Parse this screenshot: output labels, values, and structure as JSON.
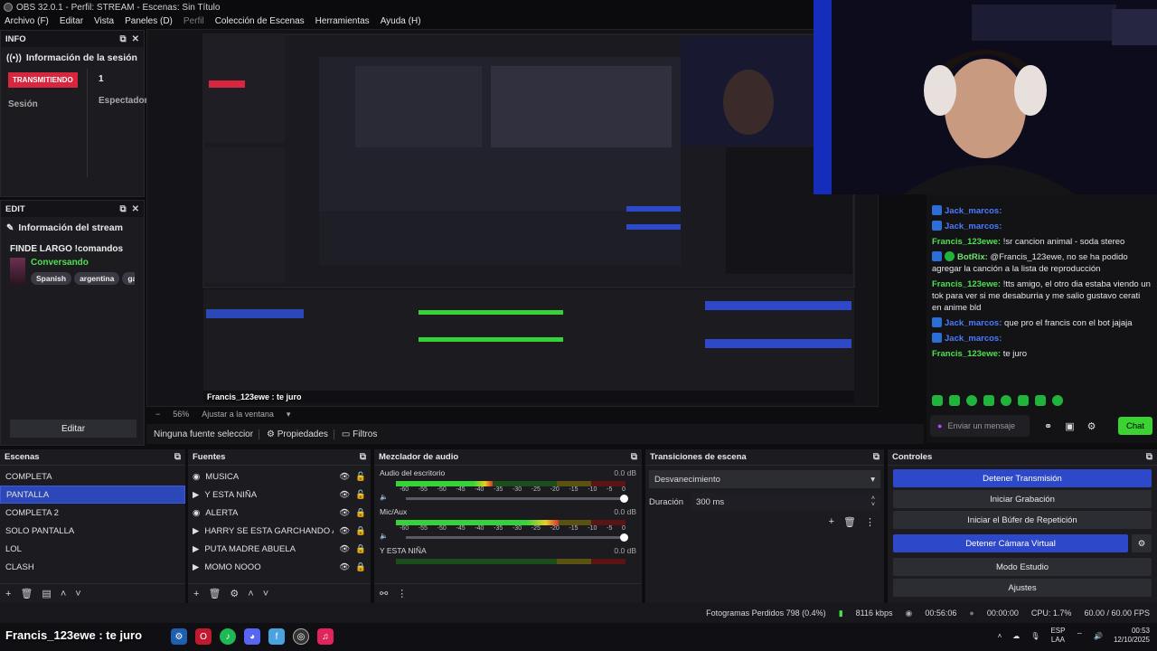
{
  "window": {
    "title": "OBS 32.0.1 - Perfil: STREAM - Escenas: Sin Título"
  },
  "menu": [
    "Archivo (F)",
    "Editar",
    "Vista",
    "Paneles (D)",
    "Perfil",
    "Colección de Escenas",
    "Herramientas",
    "Ayuda (H)"
  ],
  "info_dock": {
    "title": "INFO",
    "section": "Información de la sesión",
    "live_badge": "TRANSMITIENDO",
    "session_label": "Sesión",
    "viewers_count": "1",
    "viewers_label": "Espectador"
  },
  "edit_dock": {
    "title": "EDIT",
    "section": "Información del stream",
    "stream_title": "FINDE LARGO !comandos",
    "category": "Conversando",
    "tags": [
      "Spanish",
      "argentina",
      "ga"
    ],
    "edit_button": "Editar"
  },
  "preview_toolbar": {
    "zoom": "56%",
    "fit_label": "Ajustar a la ventana",
    "no_source": "Ninguna fuente seleccionad",
    "properties_button": "Propiedades",
    "filters_button": "Filtros"
  },
  "scenes": {
    "title": "Escenas",
    "items": [
      "COMPLETA",
      "PANTALLA",
      "COMPLETA 2",
      "SOLO PANTALLA",
      "LOL",
      "CLASH"
    ],
    "selected": "PANTALLA"
  },
  "sources": {
    "title": "Fuentes",
    "items": [
      "MUSICA",
      "Y ESTA NIÑA",
      "ALERTA",
      "HARRY SE ESTA GARCHANDO A TC",
      "PUTA MADRE ABUELA",
      "MOMO NOOO"
    ]
  },
  "mixer": {
    "title": "Mezclador de audio",
    "channels": [
      {
        "name": "Audio del escritorio",
        "db": "0.0 dB",
        "level": 0.42
      },
      {
        "name": "Mic/Aux",
        "db": "0.0 dB",
        "level": 0.71
      },
      {
        "name": "Y ESTA NIÑA",
        "db": "0.0 dB",
        "level": 0.0
      }
    ],
    "scale": [
      "-60",
      "-55",
      "-50",
      "-45",
      "-40",
      "-35",
      "-30",
      "-25",
      "-20",
      "-15",
      "-10",
      "-5",
      "0"
    ]
  },
  "transitions": {
    "title": "Transiciones de escena",
    "selected": "Desvanecimiento",
    "duration_label": "Duración",
    "duration_value": "300 ms"
  },
  "controls": {
    "title": "Controles",
    "buttons": [
      "Detener Transmisión",
      "Iniciar Grabación",
      "Iniciar el Búfer de Repetición",
      "Detener Cámara Virtual",
      "Modo Estudio",
      "Ajustes"
    ]
  },
  "statusbar": {
    "dropped": "Fotogramas Perdidos 798 (0.4%)",
    "bitrate": "8116 kbps",
    "live_time": "00:56:06",
    "rec_time": "00:00:00",
    "cpu": "CPU: 1.7%",
    "fps": "60.00 / 60.00 FPS"
  },
  "chat": {
    "messages": [
      {
        "user": "Jack_marcos:",
        "text": "",
        "badge": "blue",
        "color": "blue"
      },
      {
        "user": "Jack_marcos:",
        "text": "",
        "badge": "blue",
        "color": "blue"
      },
      {
        "user": "Francis_123ewe:",
        "text": "!sr cancion animal - soda stereo",
        "badge": "",
        "color": "green"
      },
      {
        "user": "BotRix:",
        "text": "@Francis_123ewe, no se ha podido agregar la canción a la lista de reproducción",
        "badge": "bot",
        "color": "bot"
      },
      {
        "user": "Francis_123ewe:",
        "text": "!tts amigo, el otro dia estaba viendo un tok para ver si me desaburria y me salio gustavo cerati en anime bld",
        "badge": "",
        "color": "green"
      },
      {
        "user": "Jack_marcos:",
        "text": "que pro el francis con el bot jajaja",
        "badge": "blue",
        "color": "blue"
      },
      {
        "user": "Jack_marcos:",
        "text": "",
        "badge": "blue",
        "color": "blue"
      },
      {
        "user": "Francis_123ewe:",
        "text": "te juro",
        "badge": "",
        "color": "green"
      }
    ],
    "input_placeholder": "Enviar un mensaje",
    "send_button": "Chat"
  },
  "overlay_text": "Francis_123ewe : te juro",
  "taskbar": {
    "lang": "ESP",
    "lang_sub": "LAA",
    "time": "00:53",
    "date": "12/10/2025"
  },
  "colors": {
    "accent": "#2d48c8",
    "live": "#d7263d",
    "chat_green": "#4fe04f",
    "chat_blue": "#4a7cff"
  }
}
